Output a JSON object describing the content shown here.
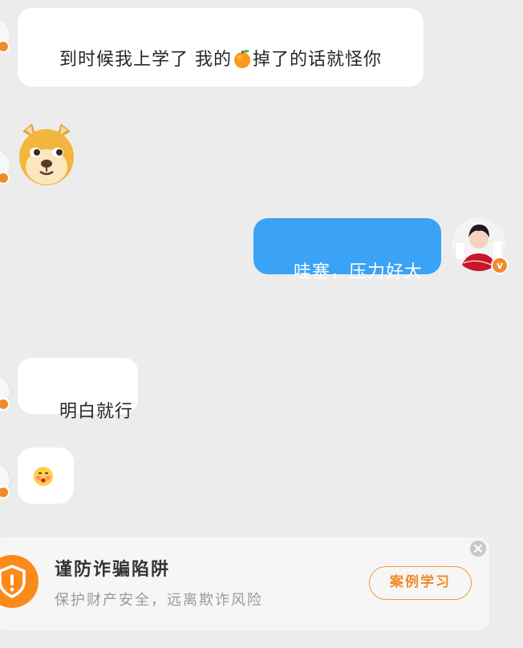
{
  "messages": [
    {
      "side": "left",
      "text_before": "到时候我上学了 我的",
      "emoji": "orange-emoji",
      "text_after": "掉了的话就怪你"
    },
    {
      "side": "left",
      "sticker": "doge-face-sticker"
    },
    {
      "side": "right",
      "text": "哇塞，压力好大"
    },
    {
      "side": "left",
      "text": "明白就行"
    },
    {
      "side": "left",
      "sticker": "embarrassed-face-emoji"
    }
  ],
  "fraud_banner": {
    "title": "谨防诈骗陷阱",
    "subtitle": "保护财产安全，远离欺诈风险",
    "button_label": "案例学习",
    "icon": "shield-exclamation-icon",
    "close_icon": "close-icon"
  },
  "colors": {
    "chat_background": "#ececec",
    "received_bubble": "#ffffff",
    "sent_bubble": "#3aa3f5",
    "accent_orange": "#f08a2a"
  }
}
